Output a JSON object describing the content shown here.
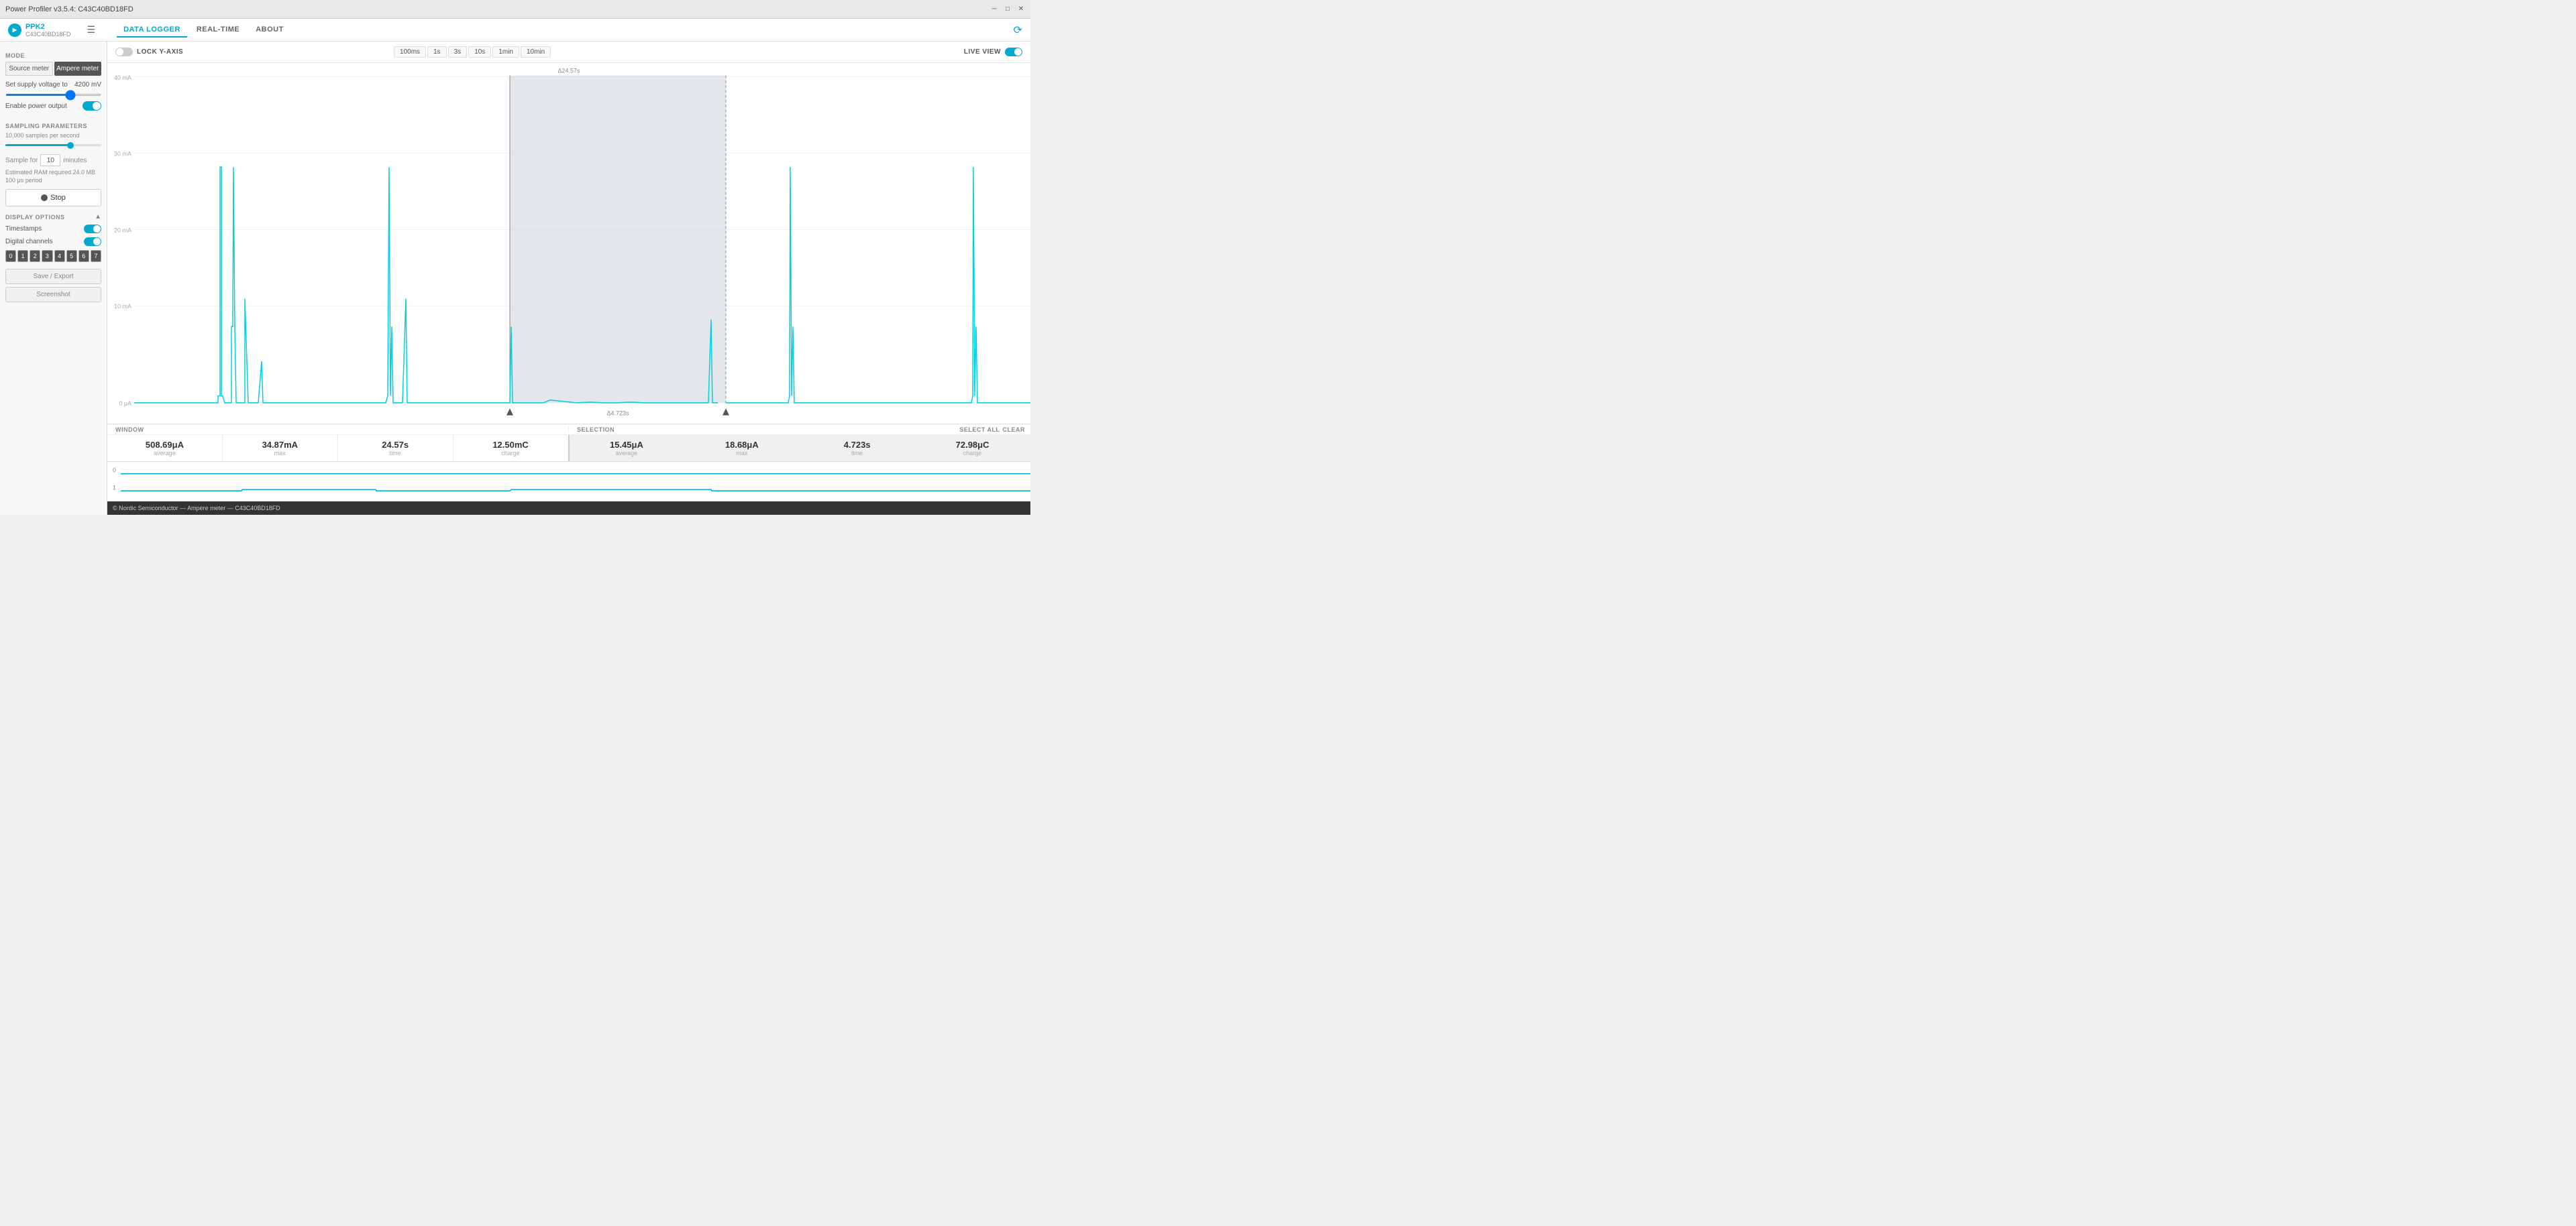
{
  "titleBar": {
    "title": "Power Profiler v3.5.4: C43C40BD18FD",
    "controls": [
      "minimize",
      "maximize",
      "close"
    ]
  },
  "header": {
    "logo": {
      "symbol": "▶",
      "name": "PPK2",
      "subtitle": "C43C40BD18FD"
    },
    "collapse_icon": "☰",
    "tabs": [
      {
        "id": "data-logger",
        "label": "DATA LOGGER",
        "active": true
      },
      {
        "id": "real-time",
        "label": "REAL-TIME",
        "active": false
      },
      {
        "id": "about",
        "label": "ABOUT",
        "active": false
      }
    ],
    "right_icon": "⟳"
  },
  "sidebar": {
    "mode_label": "MODE",
    "mode_buttons": [
      {
        "id": "source-meter",
        "label": "Source meter",
        "active": false
      },
      {
        "id": "ampere-meter",
        "label": "Ampere meter",
        "active": true
      }
    ],
    "voltage_label": "Set supply voltage to",
    "voltage_value": "4200",
    "voltage_unit": "mV",
    "power_output_label": "Enable power output",
    "power_output_enabled": true,
    "sampling_label": "SAMPLING PARAMETERS",
    "sampling_rate_label": "10,000 samples per second",
    "sample_for_label": "Sample for",
    "sample_for_value": "10",
    "sample_for_unit": "minutes",
    "ram_info": "Estimated RAM required 24.0 MB",
    "period_info": "100 μs period",
    "stop_btn_label": "Stop",
    "display_options_label": "DISPLAY OPTIONS",
    "timestamps_label": "Timestamps",
    "timestamps_enabled": true,
    "digital_channels_label": "Digital channels",
    "digital_channels_enabled": true,
    "channels": [
      "0",
      "1",
      "2",
      "3",
      "4",
      "5",
      "6",
      "7"
    ],
    "save_export_label": "Save / Export",
    "screenshot_label": "Screenshot"
  },
  "chartToolbar": {
    "lock_y_axis_label": "LOCK Y-AXIS",
    "lock_y_axis_enabled": false,
    "time_buttons": [
      "100ms",
      "1s",
      "3s",
      "10s",
      "1min",
      "10min"
    ],
    "live_view_label": "LIVE VIEW",
    "live_view_enabled": true
  },
  "chart": {
    "y_labels": [
      "40 mA",
      "30 mA",
      "20 mA",
      "10 mA",
      "0 μA"
    ],
    "delta_label": "Δ24.57s",
    "selection_delta": "Δ4.723s",
    "selection_enabled": true
  },
  "stats": {
    "window_label": "WINDOW",
    "selection_label": "SELECTION",
    "select_all_btn": "SELECT ALL",
    "clear_btn": "CLEAR",
    "window_stats": [
      {
        "value": "508.69μA",
        "label": "average"
      },
      {
        "value": "34.87mA",
        "label": "max"
      },
      {
        "value": "24.57s",
        "label": "time"
      },
      {
        "value": "12.50mC",
        "label": "charge"
      }
    ],
    "selection_stats": [
      {
        "value": "15.45μA",
        "label": "average"
      },
      {
        "value": "18.68μA",
        "label": "max"
      },
      {
        "value": "4.723s",
        "label": "time"
      },
      {
        "value": "72.98μC",
        "label": "charge"
      }
    ]
  },
  "digitalChannels": {
    "channel0_label": "0",
    "channel1_label": "1"
  },
  "statusBar": {
    "text": "© Nordic Semiconductor — Ampere meter — C43C40BD18FD"
  }
}
